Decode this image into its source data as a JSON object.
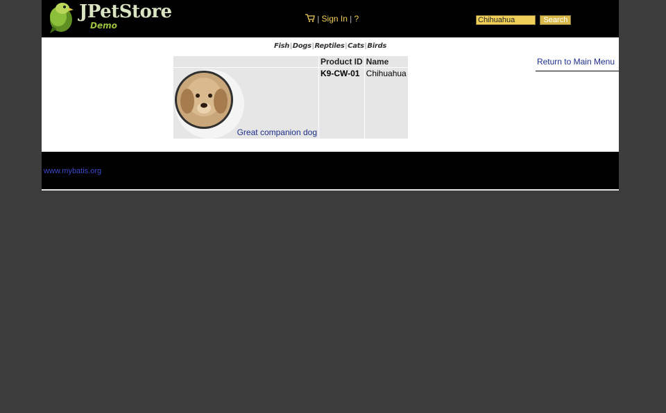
{
  "header": {
    "logo_title": "JPetStore",
    "logo_subtitle": "Demo",
    "sign_in": "Sign In",
    "help": "?",
    "separator": "|",
    "search_value": "Chihuahua",
    "search_button": "Search"
  },
  "quicklinks": [
    "Fish",
    "Dogs",
    "Reptiles",
    "Cats",
    "Birds"
  ],
  "nav": {
    "return_link": "Return to Main Menu"
  },
  "table": {
    "headers": [
      "",
      "Product ID",
      "Name"
    ],
    "rows": [
      {
        "description": "Great companion dog",
        "product_id": "K9-CW-01",
        "name": "Chihuahua"
      }
    ]
  },
  "footer": {
    "link": "www.mybatis.org"
  }
}
